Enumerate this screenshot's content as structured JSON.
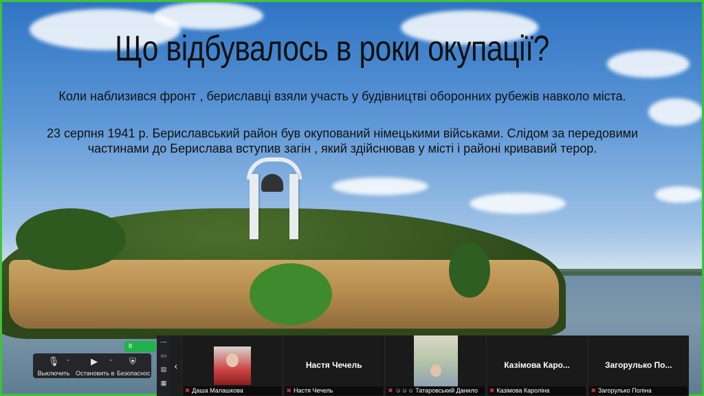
{
  "slide": {
    "title": "Що відбувалось в роки окупації?",
    "paragraph1": "Коли наблизився фронт , бериславці  взяли участь у будівництві оборонних рубежів навколо міста.",
    "paragraph2": "23 серпня 1941 р. Бериславський район був окупований німецькими військами. Слідом за передовими частинами до Берислава  вступив загін , який  здійснював у місті і районі кривавий терор."
  },
  "controls": {
    "mute_label": "Выключить",
    "video_label": "Остановить в",
    "security_label": "Безопаснос",
    "security_badge": "В"
  },
  "participants": [
    {
      "display_name": "Даша Малашкова",
      "big_name": "",
      "has_video": true
    },
    {
      "display_name": "Настя Чечель",
      "big_name": "Настя Чечель",
      "has_video": false
    },
    {
      "display_name": "Татаровський Данило",
      "big_name": "",
      "has_video": true
    },
    {
      "display_name": "Казімова Кароліна",
      "big_name": "Казімова Каро...",
      "has_video": false
    },
    {
      "display_name": "Загорулько Поліна",
      "big_name": "Загорулько По...",
      "has_video": false
    }
  ],
  "colors": {
    "frame_border": "#3fc23a",
    "mute_red": "#e0353a",
    "security_green": "#22b14c"
  },
  "icons": {
    "mic": "microphone-icon",
    "video": "camera-icon",
    "security": "shield-icon"
  }
}
